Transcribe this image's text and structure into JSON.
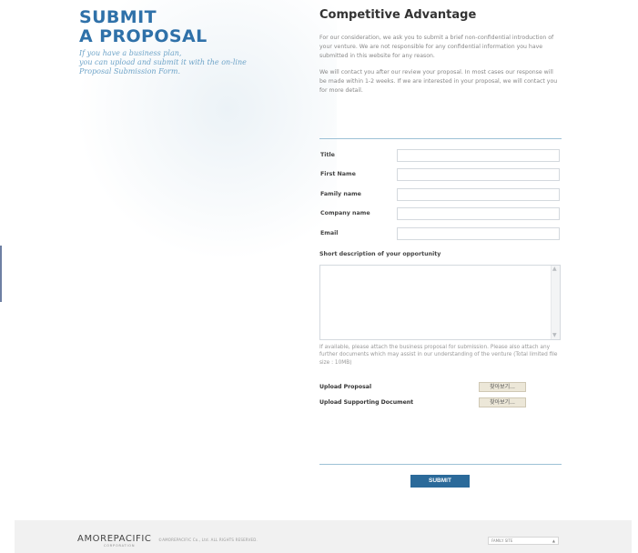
{
  "intro": {
    "headline_line1": "SUBMIT",
    "headline_line2": "A PROPOSAL",
    "subtitle_line1": "If you have a business plan,",
    "subtitle_line2": "you can upload and submit it with the on-line",
    "subtitle_line3": "Proposal Submission Form."
  },
  "content": {
    "title": "Competitive Advantage",
    "paragraph1": "For our consideration, we ask you to submit a brief non-confidential introduction of your venture. We are not responsible for any confidential information you have submitted in this website for any reason.",
    "paragraph2": "We will contact you after our review your proposal. In most cases our response will be made within 1-2 weeks. If we are interested in your proposal, we will contact you for more detail."
  },
  "form": {
    "fields": [
      {
        "label": "Title",
        "value": ""
      },
      {
        "label": "First Name",
        "value": ""
      },
      {
        "label": "Family name",
        "value": ""
      },
      {
        "label": "Company name",
        "value": ""
      },
      {
        "label": "Email",
        "value": ""
      }
    ],
    "description_label": "Short description of your opportunity",
    "description_value": "",
    "attach_note": "If available, please attach the business proposal for submission. Please also attach any further documents which may assist in our understanding of the venture (Total limited file size : 10MB)",
    "uploads": [
      {
        "label": "Upload Proposal",
        "button": "찾아보기..."
      },
      {
        "label": "Upload Supporting Document",
        "button": "찾아보기..."
      }
    ],
    "submit_label": "SUBMIT"
  },
  "footer": {
    "logo": "AMOREPACIFIC",
    "logo_sub": "CORPORATION",
    "copyright": "©AMOREPACIFIC Co., Ltd. ALL RIGHTS RESERVED.",
    "family_site": "FAMILY SITE"
  }
}
